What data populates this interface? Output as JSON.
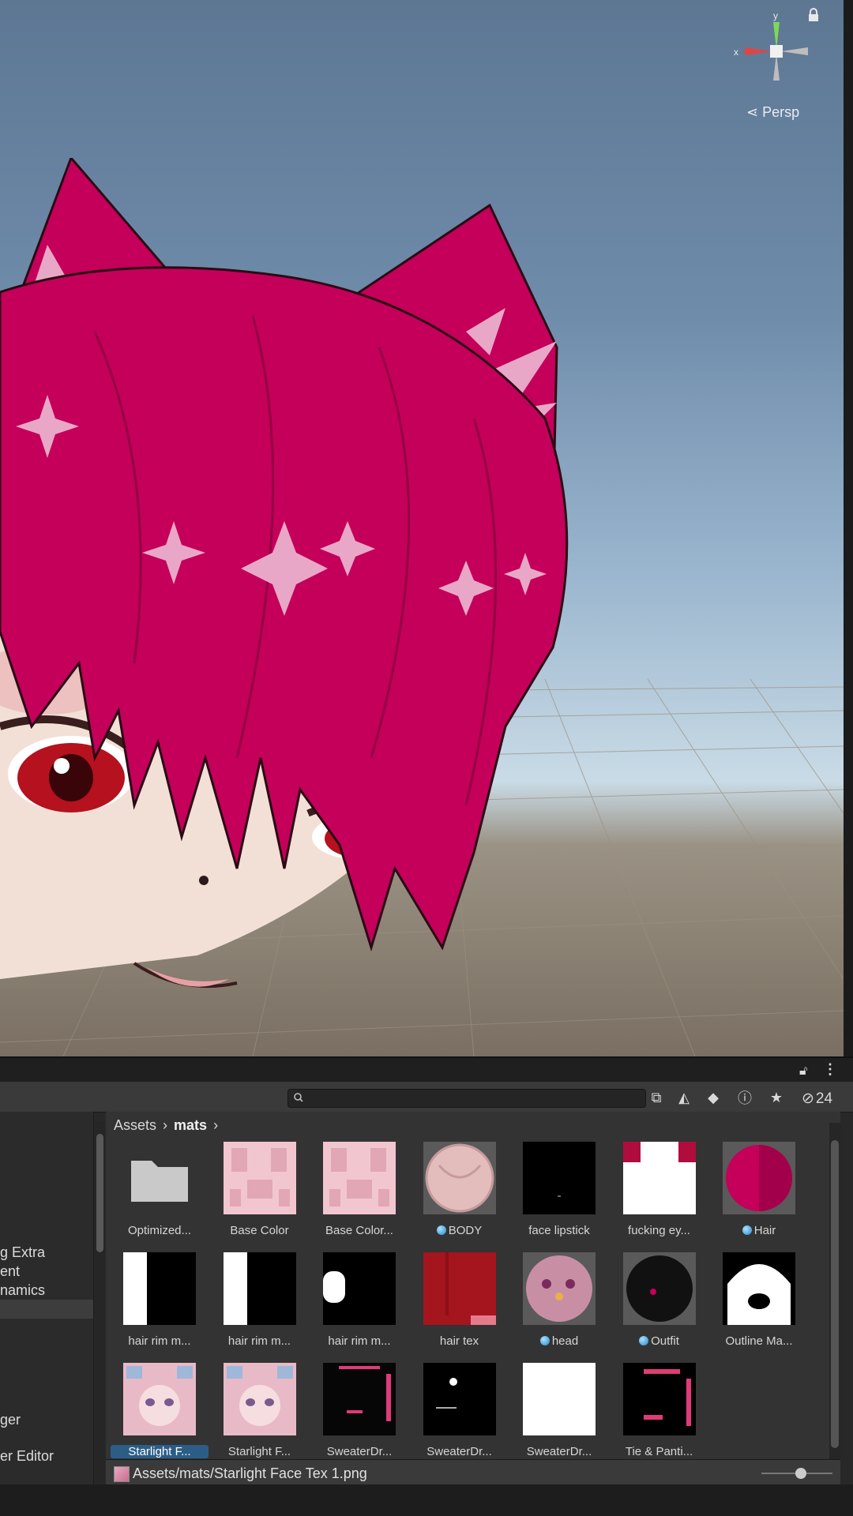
{
  "scene": {
    "persp_label": "Persp",
    "gizmo_axes": {
      "x": "x",
      "y": "y"
    }
  },
  "project": {
    "hidden_count": "24",
    "search": {
      "placeholder": ""
    },
    "left_items": [
      "g Extra",
      "ent",
      "namics",
      "",
      "",
      "",
      "",
      "ger",
      "er Editor"
    ],
    "breadcrumb": {
      "root": "Assets",
      "folder": "mats"
    },
    "assets": [
      {
        "name": "Optimized...",
        "kind": "folder"
      },
      {
        "name": "Base Color",
        "kind": "texture-pink"
      },
      {
        "name": "Base Color...",
        "kind": "texture-pink"
      },
      {
        "name": "BODY",
        "kind": "material-sphere",
        "material": true
      },
      {
        "name": "face lipstick",
        "kind": "black"
      },
      {
        "name": "fucking ey...",
        "kind": "white-eyes"
      },
      {
        "name": "Hair",
        "kind": "material-hair",
        "material": true
      },
      {
        "name": "hair rim m...",
        "kind": "white-black"
      },
      {
        "name": "hair rim m...",
        "kind": "white-black"
      },
      {
        "name": "hair rim m...",
        "kind": "blob"
      },
      {
        "name": "hair tex",
        "kind": "hair-tex"
      },
      {
        "name": "head",
        "kind": "head-sphere",
        "material": true
      },
      {
        "name": "Outfit",
        "kind": "outfit-sphere",
        "material": true
      },
      {
        "name": "Outline Ma...",
        "kind": "outline"
      },
      {
        "name": "Starlight F...",
        "kind": "face-tex",
        "selected": true
      },
      {
        "name": "Starlight F...",
        "kind": "face-tex"
      },
      {
        "name": "SweaterDr...",
        "kind": "sweater-a"
      },
      {
        "name": "SweaterDr...",
        "kind": "sweater-b"
      },
      {
        "name": "SweaterDr...",
        "kind": "white"
      },
      {
        "name": "Tie & Panti...",
        "kind": "tie"
      }
    ],
    "status_path": "Assets/mats/Starlight Face Tex 1.png",
    "zoom": 0.55
  },
  "colors": {
    "hair": "#c4005a",
    "selection": "#2c5d87",
    "accent_star": "#e9a7c7"
  }
}
